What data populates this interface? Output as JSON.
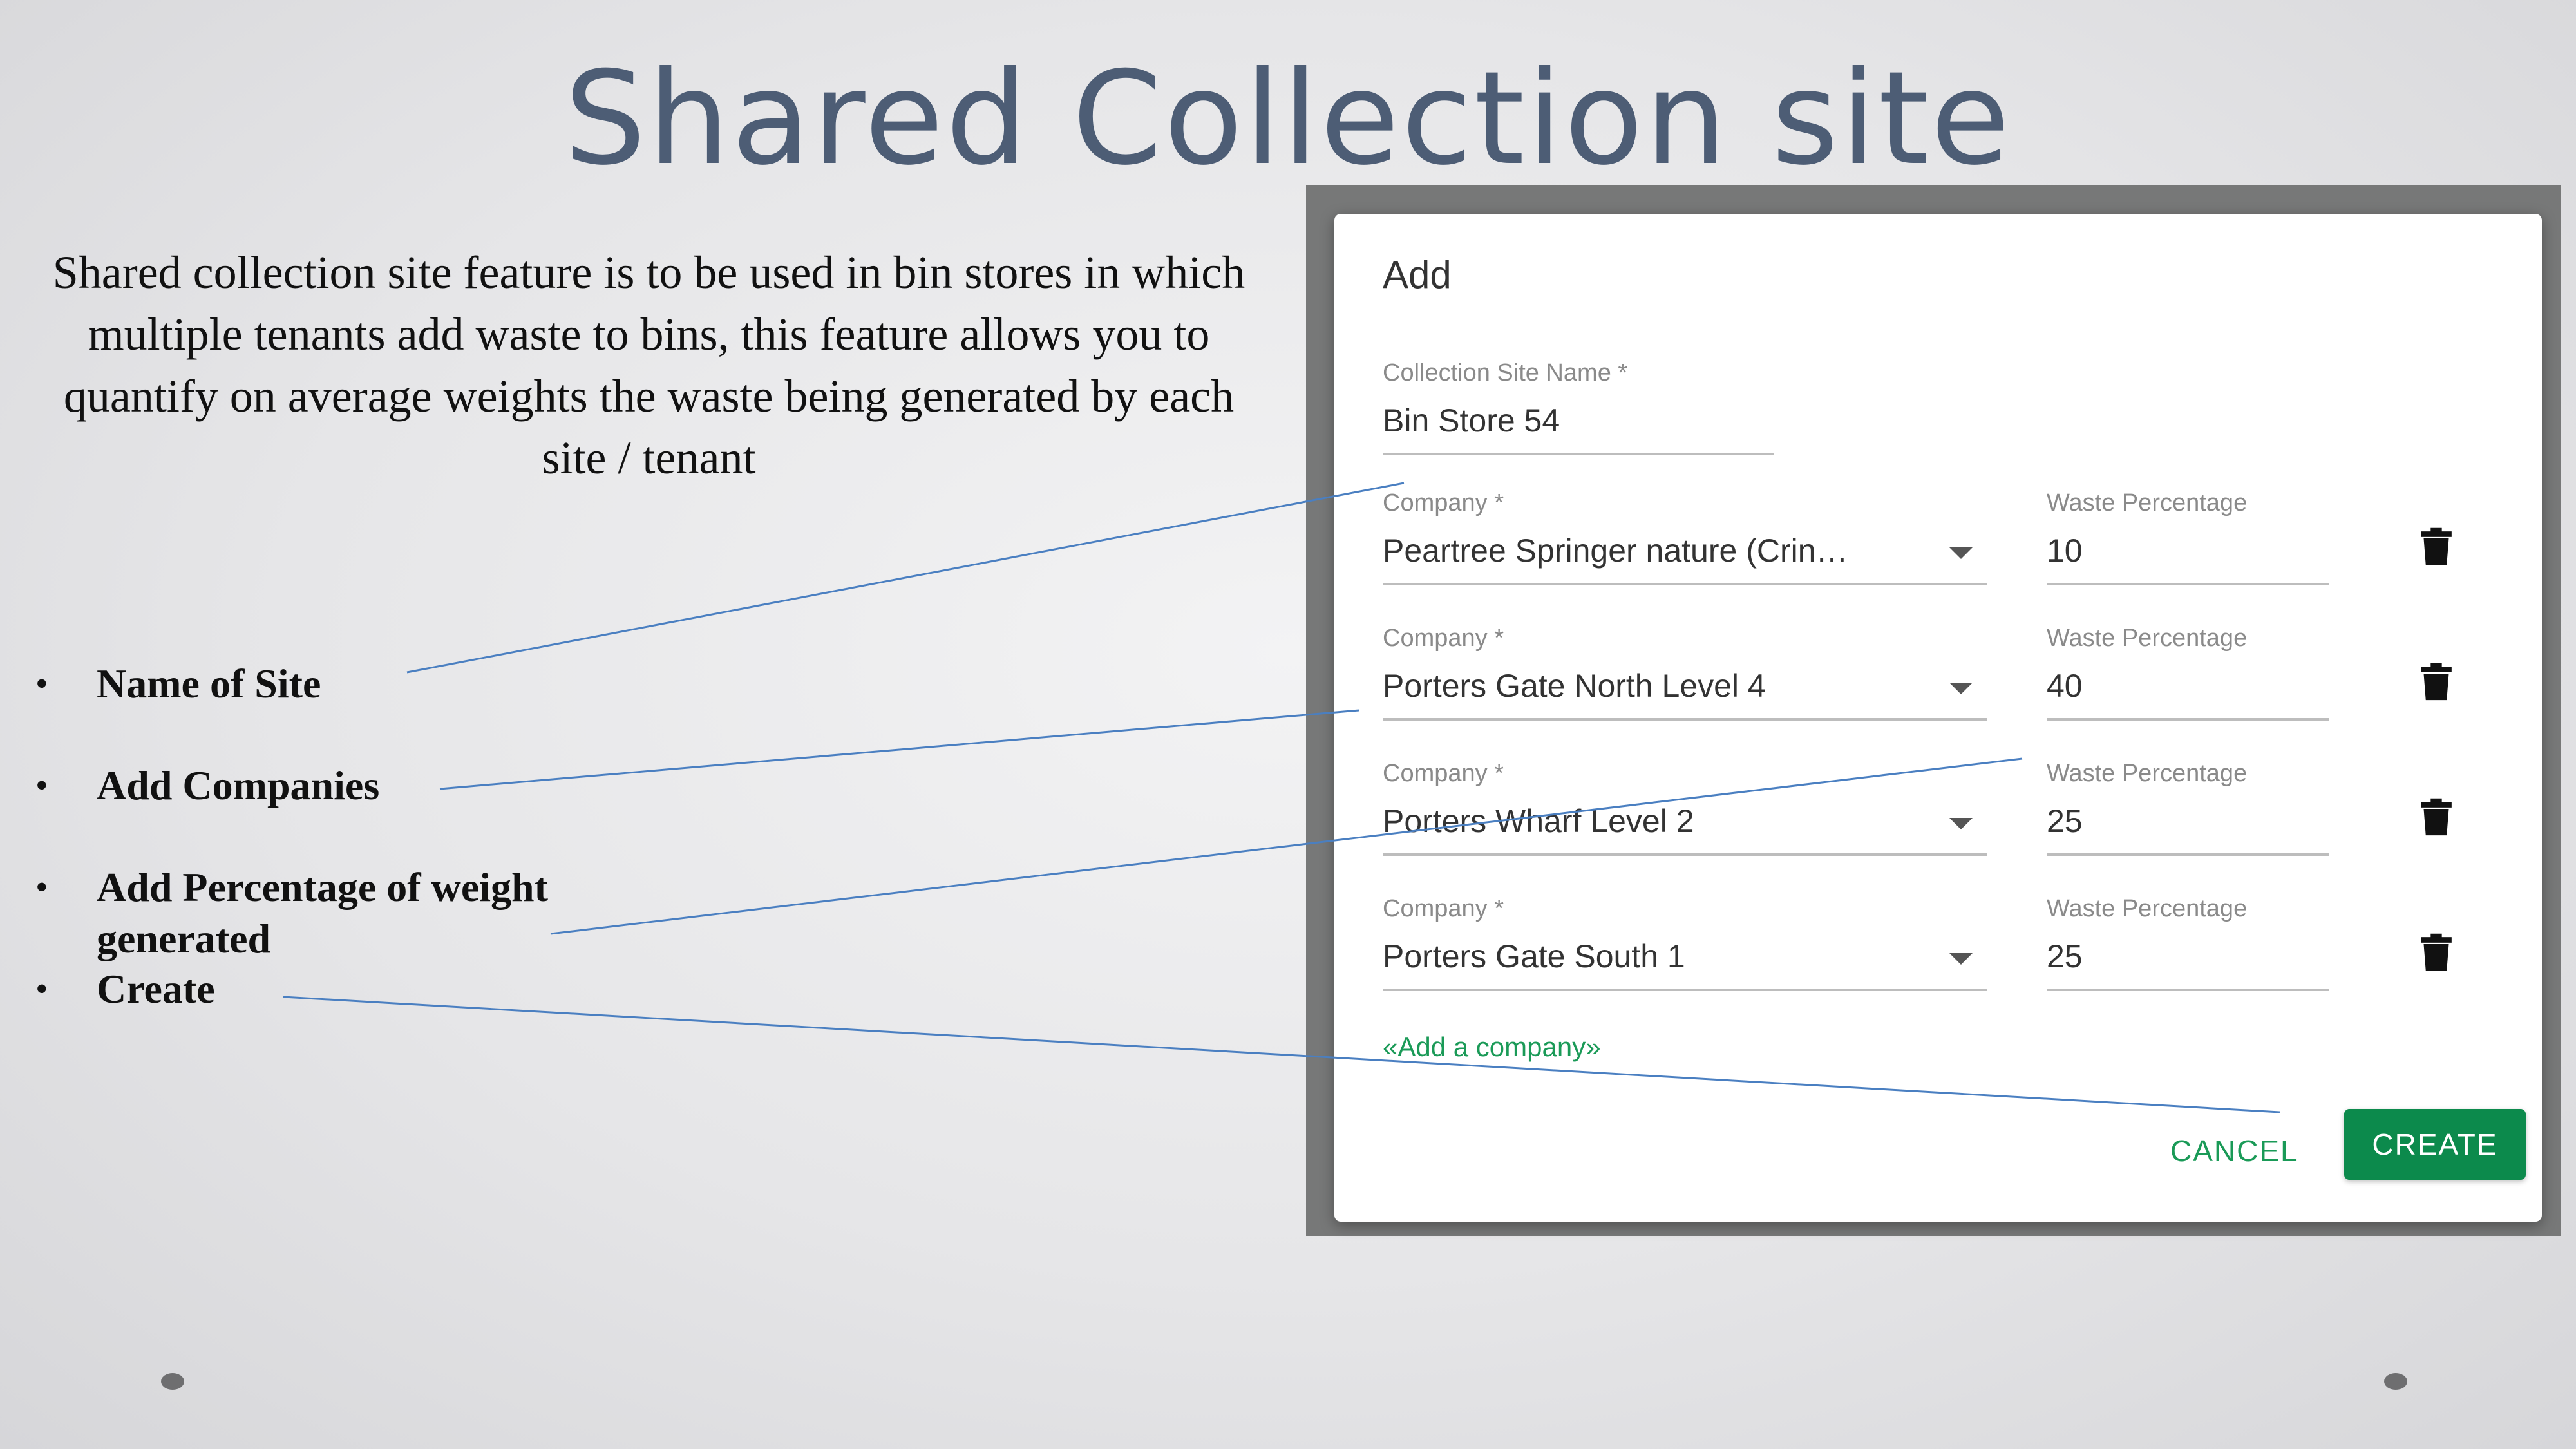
{
  "slide": {
    "title": "Shared Collection site",
    "intro": "Shared collection site feature is to be used in bin stores in which multiple tenants add waste to bins, this feature allows you to quantify on average weights the waste being generated by each site / tenant",
    "bullet_symbol": "•",
    "bullets": [
      "Name of Site",
      "Add Companies",
      "Add Percentage of weight generated",
      "Create"
    ]
  },
  "dialog": {
    "title": "Add",
    "site_name_label": "Collection Site Name *",
    "site_name_value": "Bin Store 54",
    "company_label": "Company *",
    "percentage_label": "Waste Percentage",
    "rows": [
      {
        "company": "Peartree Springer nature (Crin…",
        "percentage": "10"
      },
      {
        "company": "Porters Gate North Level 4",
        "percentage": "40"
      },
      {
        "company": "Porters Wharf Level 2",
        "percentage": "25"
      },
      {
        "company": "Porters Gate South 1",
        "percentage": "25"
      }
    ],
    "add_company_link": "«Add a company»",
    "cancel_label": "CANCEL",
    "create_label": "CREATE"
  },
  "colors": {
    "accent_green": "#0c8a4c",
    "link_green": "#1a9a57",
    "title_slate": "#4d5d75",
    "annotation_line": "#4a7fc1"
  },
  "icons": [
    "chevron-down-icon",
    "trash-icon"
  ]
}
